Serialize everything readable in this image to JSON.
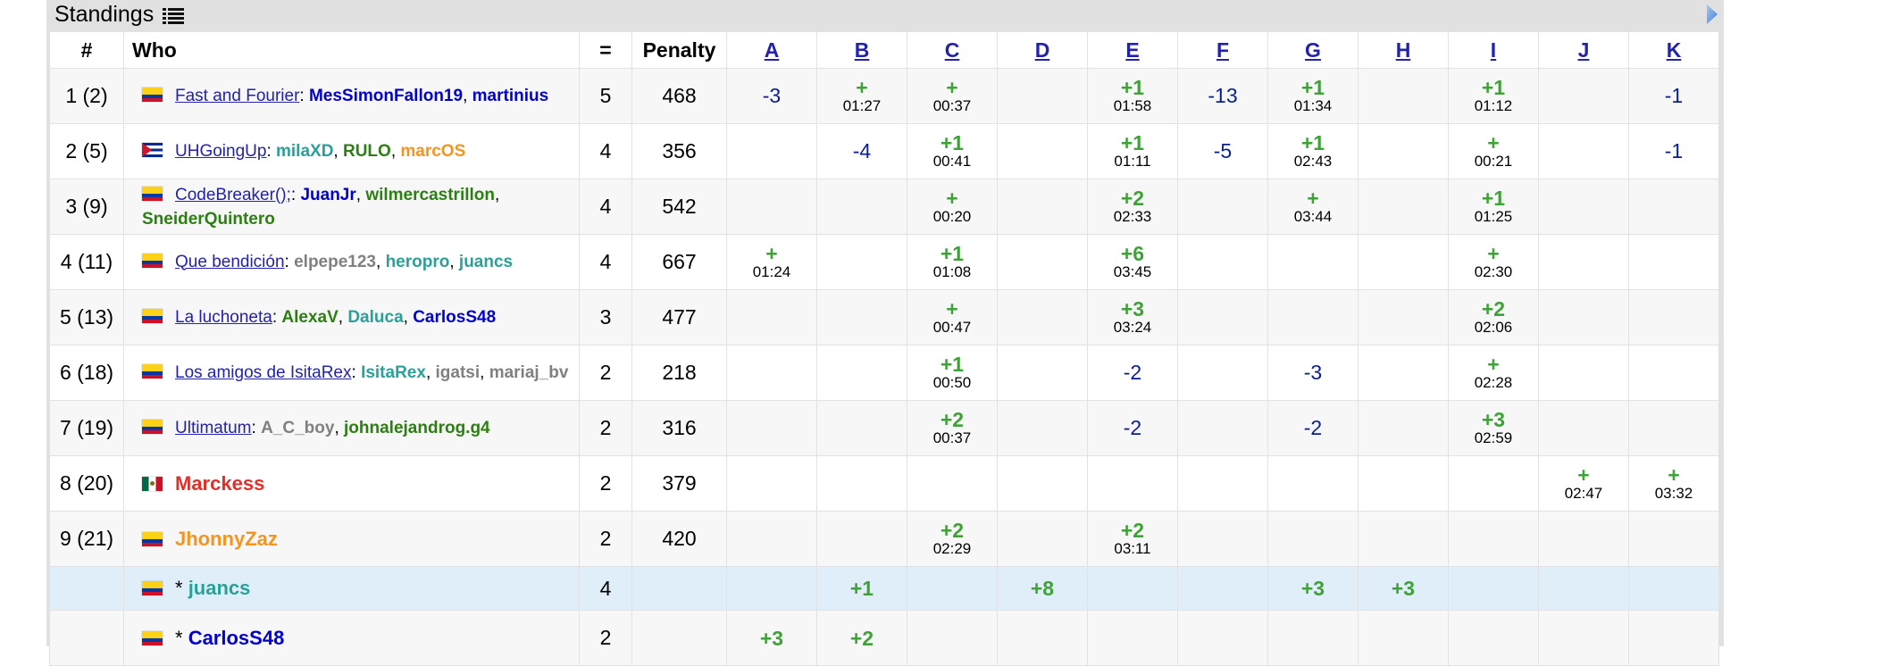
{
  "header": {
    "title": "Standings"
  },
  "columns": [
    "#",
    "Who",
    "=",
    "Penalty",
    "A",
    "B",
    "C",
    "D",
    "E",
    "F",
    "G",
    "H",
    "I",
    "J",
    "K"
  ],
  "colors": {
    "accepted": "#3fa238",
    "rejected": "#0a1f8f",
    "link": "#2222aa",
    "virtual_row": "#e0eefa"
  },
  "rows": [
    {
      "rank": "1 (2)",
      "flag": "colombia-flag",
      "team": "Fast and Fourier",
      "members": [
        {
          "name": "MesSimonFallon19",
          "color": "blue"
        },
        {
          "name": "martinius",
          "color": "blue"
        }
      ],
      "solved": "5",
      "penalty": "468",
      "cells": [
        {
          "mark": "-3",
          "type": "rej"
        },
        {
          "mark": "+",
          "time": "01:27",
          "type": "ac"
        },
        {
          "mark": "+",
          "time": "00:37",
          "type": "ac"
        },
        {},
        {
          "mark": "+1",
          "time": "01:58",
          "type": "ac"
        },
        {
          "mark": "-13",
          "type": "rej"
        },
        {
          "mark": "+1",
          "time": "01:34",
          "type": "ac"
        },
        {},
        {
          "mark": "+1",
          "time": "01:12",
          "type": "ac"
        },
        {},
        {
          "mark": "-1",
          "type": "rej"
        }
      ]
    },
    {
      "rank": "2 (5)",
      "flag": "cuba-flag",
      "team": "UHGoingUp",
      "members": [
        {
          "name": "milaXD",
          "color": "teal"
        },
        {
          "name": "RULO",
          "color": "green"
        },
        {
          "name": "marcOS",
          "color": "orange"
        }
      ],
      "solved": "4",
      "penalty": "356",
      "cells": [
        {},
        {
          "mark": "-4",
          "type": "rej"
        },
        {
          "mark": "+1",
          "time": "00:41",
          "type": "ac"
        },
        {},
        {
          "mark": "+1",
          "time": "01:11",
          "type": "ac"
        },
        {
          "mark": "-5",
          "type": "rej"
        },
        {
          "mark": "+1",
          "time": "02:43",
          "type": "ac"
        },
        {},
        {
          "mark": "+",
          "time": "00:21",
          "type": "ac"
        },
        {},
        {
          "mark": "-1",
          "type": "rej"
        }
      ]
    },
    {
      "rank": "3 (9)",
      "flag": "colombia-flag",
      "team": "CodeBreaker();",
      "members": [
        {
          "name": "JuanJr",
          "color": "blue"
        },
        {
          "name": "wilmercastrillon",
          "color": "green"
        },
        {
          "name": "SneiderQuintero",
          "color": "green"
        }
      ],
      "solved": "4",
      "penalty": "542",
      "cells": [
        {},
        {},
        {
          "mark": "+",
          "time": "00:20",
          "type": "ac"
        },
        {},
        {
          "mark": "+2",
          "time": "02:33",
          "type": "ac"
        },
        {},
        {
          "mark": "+",
          "time": "03:44",
          "type": "ac"
        },
        {},
        {
          "mark": "+1",
          "time": "01:25",
          "type": "ac"
        },
        {},
        {}
      ]
    },
    {
      "rank": "4 (11)",
      "flag": "colombia-flag",
      "team": "Que bendición",
      "members": [
        {
          "name": "elpepe123",
          "color": "gray"
        },
        {
          "name": "heropro",
          "color": "teal"
        },
        {
          "name": "juancs",
          "color": "teal"
        }
      ],
      "solved": "4",
      "penalty": "667",
      "cells": [
        {
          "mark": "+",
          "time": "01:24",
          "type": "ac"
        },
        {},
        {
          "mark": "+1",
          "time": "01:08",
          "type": "ac"
        },
        {},
        {
          "mark": "+6",
          "time": "03:45",
          "type": "ac"
        },
        {},
        {},
        {},
        {
          "mark": "+",
          "time": "02:30",
          "type": "ac"
        },
        {},
        {}
      ]
    },
    {
      "rank": "5 (13)",
      "flag": "colombia-flag",
      "team": "La luchoneta",
      "members": [
        {
          "name": "AlexaV",
          "color": "green"
        },
        {
          "name": "Daluca",
          "color": "teal"
        },
        {
          "name": "CarlosS48",
          "color": "blue"
        }
      ],
      "solved": "3",
      "penalty": "477",
      "cells": [
        {},
        {},
        {
          "mark": "+",
          "time": "00:47",
          "type": "ac"
        },
        {},
        {
          "mark": "+3",
          "time": "03:24",
          "type": "ac"
        },
        {},
        {},
        {},
        {
          "mark": "+2",
          "time": "02:06",
          "type": "ac"
        },
        {},
        {}
      ]
    },
    {
      "rank": "6 (18)",
      "flag": "colombia-flag",
      "team": "Los amigos de IsitaRex",
      "members": [
        {
          "name": "IsitaRex",
          "color": "teal"
        },
        {
          "name": "igatsi",
          "color": "gray"
        },
        {
          "name": "mariaj_bv",
          "color": "gray"
        }
      ],
      "solved": "2",
      "penalty": "218",
      "cells": [
        {},
        {},
        {
          "mark": "+1",
          "time": "00:50",
          "type": "ac"
        },
        {},
        {
          "mark": "-2",
          "type": "rej"
        },
        {},
        {
          "mark": "-3",
          "type": "rej"
        },
        {},
        {
          "mark": "+",
          "time": "02:28",
          "type": "ac"
        },
        {},
        {}
      ]
    },
    {
      "rank": "7 (19)",
      "flag": "colombia-flag",
      "team": "Ultimatum",
      "members": [
        {
          "name": "A_C_boy",
          "color": "gray"
        },
        {
          "name": "johnalejandrog.g4",
          "color": "green"
        }
      ],
      "solved": "2",
      "penalty": "316",
      "cells": [
        {},
        {},
        {
          "mark": "+2",
          "time": "00:37",
          "type": "ac"
        },
        {},
        {
          "mark": "-2",
          "type": "rej"
        },
        {},
        {
          "mark": "-2",
          "type": "rej"
        },
        {},
        {
          "mark": "+3",
          "time": "02:59",
          "type": "ac"
        },
        {},
        {}
      ]
    },
    {
      "rank": "8 (20)",
      "flag": "mexico-flag",
      "team": "",
      "solo": {
        "name": "Marckess",
        "color": "red"
      },
      "members": [],
      "solved": "2",
      "penalty": "379",
      "cells": [
        {},
        {},
        {},
        {},
        {},
        {},
        {},
        {},
        {},
        {
          "mark": "+",
          "time": "02:47",
          "type": "ac"
        },
        {
          "mark": "+",
          "time": "03:32",
          "type": "ac"
        }
      ]
    },
    {
      "rank": "9 (21)",
      "flag": "colombia-flag",
      "team": "",
      "solo": {
        "name": "JhonnyZaz",
        "color": "orange"
      },
      "members": [],
      "solved": "2",
      "penalty": "420",
      "cells": [
        {},
        {},
        {
          "mark": "+2",
          "time": "02:29",
          "type": "ac"
        },
        {},
        {
          "mark": "+2",
          "time": "03:11",
          "type": "ac"
        },
        {},
        {},
        {},
        {},
        {},
        {}
      ]
    },
    {
      "rank": "",
      "flag": "colombia-flag",
      "virtual": true,
      "team": "",
      "solo": {
        "name": "* juancs",
        "color": "teal"
      },
      "members": [],
      "solved": "4",
      "penalty": "",
      "cells": [
        {},
        {
          "mark": "+1",
          "type": "ac"
        },
        {},
        {
          "mark": "+8",
          "type": "ac"
        },
        {},
        {},
        {
          "mark": "+3",
          "type": "ac"
        },
        {
          "mark": "+3",
          "type": "ac"
        },
        {},
        {},
        {}
      ]
    },
    {
      "rank": "",
      "flag": "colombia-flag",
      "team": "",
      "solo": {
        "name": "* CarlosS48",
        "color": "blue"
      },
      "members": [],
      "solved": "2",
      "penalty": "",
      "cells": [
        {
          "mark": "+3",
          "type": "ac"
        },
        {
          "mark": "+2",
          "type": "ac"
        },
        {},
        {},
        {},
        {},
        {},
        {},
        {},
        {},
        {}
      ]
    }
  ]
}
